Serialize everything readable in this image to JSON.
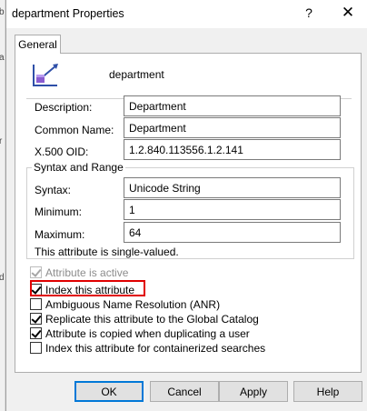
{
  "window": {
    "title": "department Properties",
    "help_glyph": "?",
    "close_glyph": "✕"
  },
  "tabs": [
    {
      "label": "General",
      "selected": true
    }
  ],
  "attribute": {
    "name": "department"
  },
  "fields": {
    "description": {
      "label": "Description:",
      "value": "Department"
    },
    "common_name": {
      "label": "Common Name:",
      "value": "Department"
    },
    "oid": {
      "label": "X.500 OID:",
      "value": "1.2.840.113556.1.2.141"
    }
  },
  "syntax_range": {
    "title": "Syntax and Range",
    "syntax": {
      "label": "Syntax:",
      "value": "Unicode String"
    },
    "minimum": {
      "label": "Minimum:",
      "value": "1"
    },
    "maximum": {
      "label": "Maximum:",
      "value": "64"
    },
    "note": "This attribute is single-valued."
  },
  "options": [
    {
      "label": "Attribute is active",
      "checked": true,
      "disabled": true
    },
    {
      "label": "Index this attribute",
      "checked": true,
      "disabled": false,
      "highlighted": true
    },
    {
      "label": "Ambiguous Name Resolution (ANR)",
      "checked": false,
      "disabled": false
    },
    {
      "label": "Replicate this attribute to the Global Catalog",
      "checked": true,
      "disabled": false
    },
    {
      "label": "Attribute is copied when duplicating a user",
      "checked": true,
      "disabled": false
    },
    {
      "label": "Index this attribute for containerized searches",
      "checked": false,
      "disabled": false
    }
  ],
  "buttons": {
    "ok": "OK",
    "cancel": "Cancel",
    "apply": "Apply",
    "help": "Help"
  },
  "colors": {
    "highlight_box": "#e00000",
    "default_button_border": "#0078d7",
    "icon_blue": "#2e4fa8",
    "icon_purple": "#8a5cd0"
  }
}
